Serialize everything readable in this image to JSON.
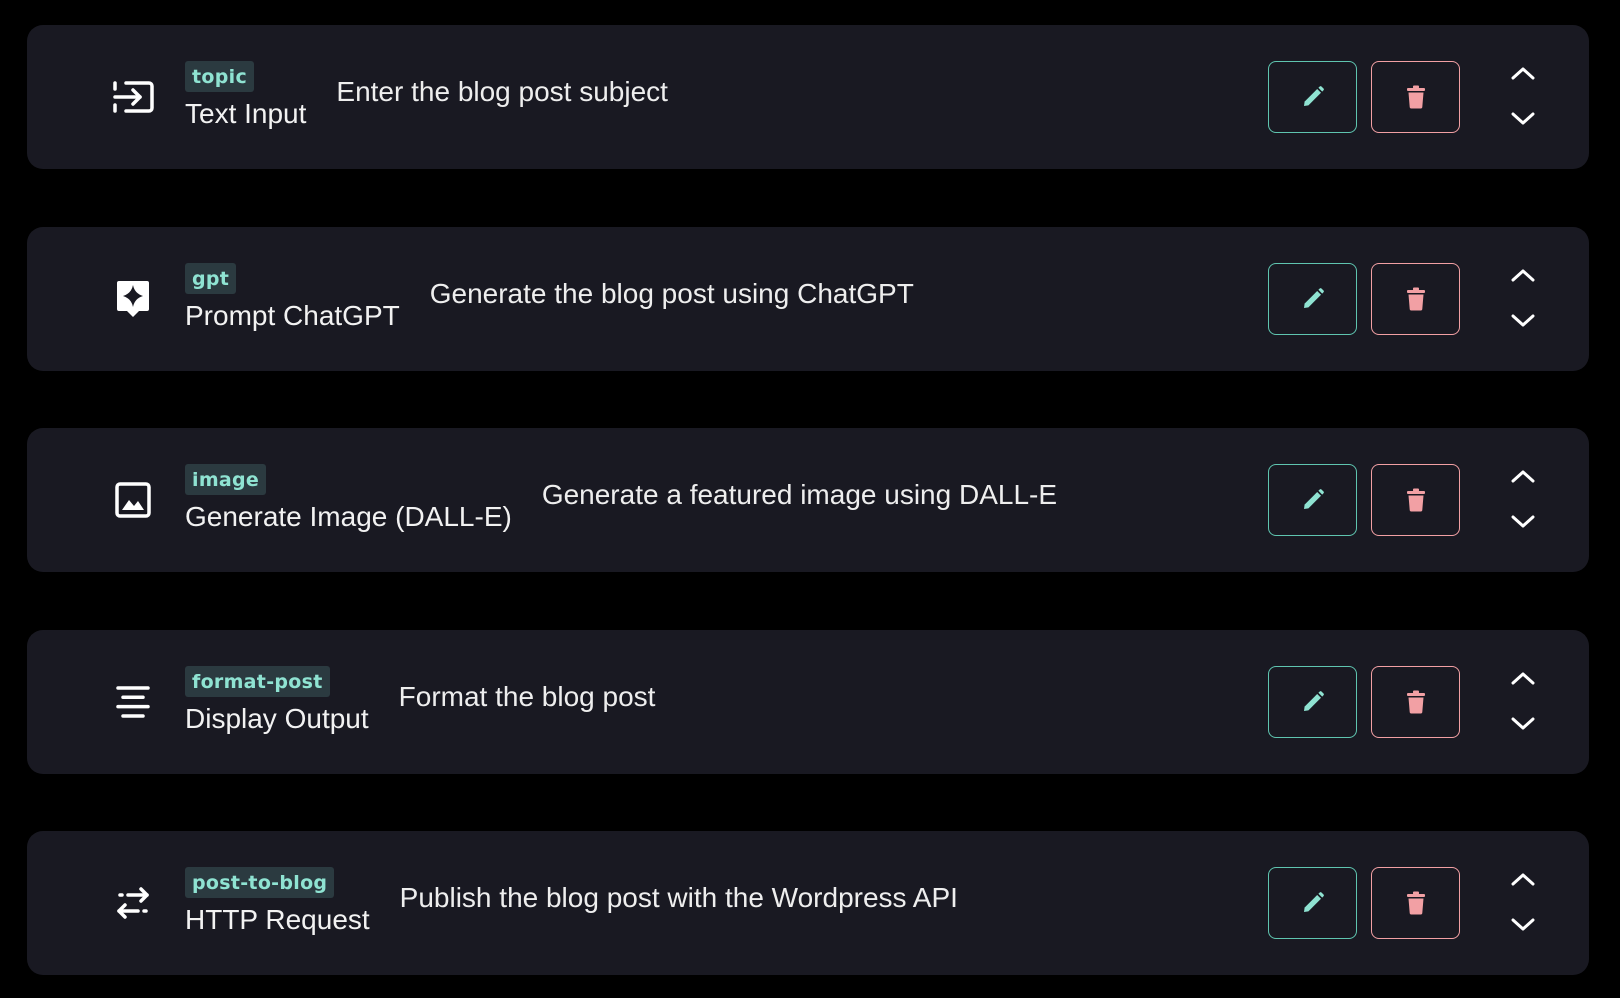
{
  "colors": {
    "background": "#000000",
    "card": "#191922",
    "tag_bg": "#2b3a40",
    "tag_text": "#8fe3d2",
    "edit_accent": "#5fc5b0",
    "delete_accent": "#f2a0a4"
  },
  "steps": [
    {
      "tag": "topic",
      "type": "Text Input",
      "description": "Enter the blog post subject",
      "icon": "input-arrow-icon"
    },
    {
      "tag": "gpt",
      "type": "Prompt ChatGPT",
      "description": "Generate the blog post using ChatGPT",
      "icon": "sparkle-icon"
    },
    {
      "tag": "image",
      "type": "Generate Image (DALL-E)",
      "description": "Generate a featured image using DALL-E",
      "icon": "image-icon"
    },
    {
      "tag": "format-post",
      "type": "Display Output",
      "description": "Format the blog post",
      "icon": "align-center-icon"
    },
    {
      "tag": "post-to-blog",
      "type": "HTTP Request",
      "description": "Publish the blog post with the Wordpress API",
      "icon": "transfer-arrows-icon"
    }
  ]
}
